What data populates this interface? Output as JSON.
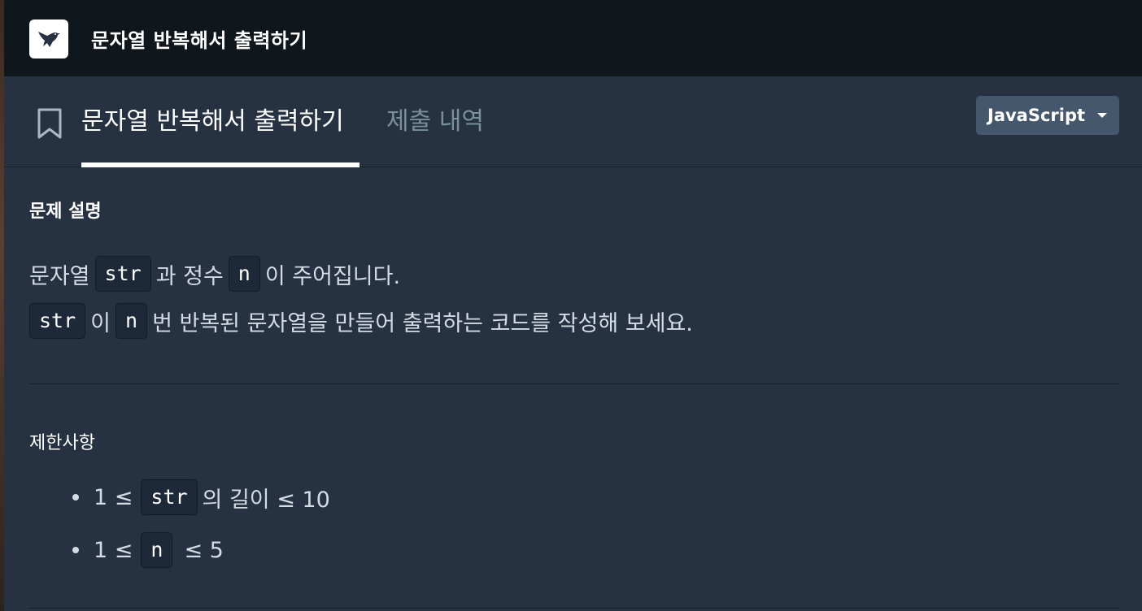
{
  "header": {
    "title": "문자열 반복해서 출력하기"
  },
  "tabs": {
    "active_label": "문자열 반복해서 출력하기",
    "submission_label": "제출 내역"
  },
  "language": {
    "selected": "JavaScript"
  },
  "description": {
    "title": "문제 설명",
    "line1": {
      "part1": "문자열",
      "code1": "str",
      "part2": "과 정수",
      "code2": "n",
      "part3": "이 주어집니다."
    },
    "line2": {
      "code1": "str",
      "part1": "이",
      "code2": "n",
      "part2": "번 반복된 문자열을 만들어 출력하는 코드를 작성해 보세요."
    }
  },
  "constraints": {
    "title": "제한사항",
    "item1": {
      "pre": "1 ≤",
      "code": "str",
      "post": "의 길이 ≤ 10"
    },
    "item2": {
      "pre": "1 ≤",
      "code": "n",
      "post": "≤ 5"
    }
  },
  "colors": {
    "topbar": "#0f161c",
    "background": "#263241",
    "select": "#44576c",
    "code_bg": "#1d2838"
  },
  "icons": {
    "logo": "hummingbird-logo-icon",
    "bookmark": "bookmark-icon",
    "dropdown": "caret-down-icon"
  }
}
